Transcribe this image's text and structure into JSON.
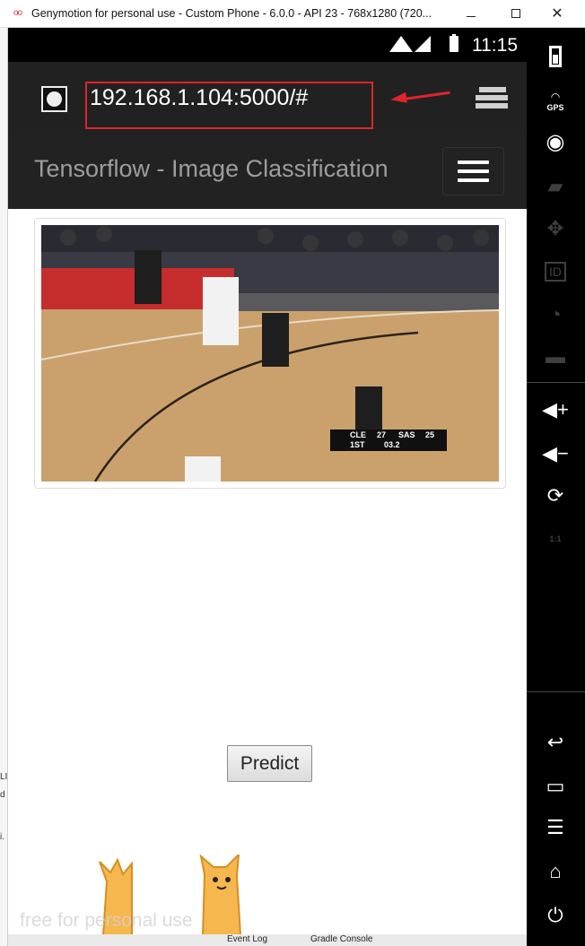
{
  "window": {
    "title": "Genymotion for personal use - Custom Phone - 6.0.0 - API 23 - 768x1280 (720...",
    "controls": {
      "minimize": "minimize-icon",
      "maximize": "maximize-icon",
      "close": "✕"
    }
  },
  "status_bar": {
    "time": "11:15",
    "icons": [
      "wifi-icon",
      "signal-icon",
      "battery-icon"
    ]
  },
  "browser": {
    "url": "192.168.1.104:5000/#",
    "annotation_color": "#e0242a"
  },
  "app": {
    "title": "Tensorflow - Image Classification",
    "navbar_color": "#222222",
    "image": {
      "scoreboard": {
        "team1": "CLE",
        "score1": "27",
        "team2": "SAS",
        "score2": "25",
        "period": "1ST",
        "clock": "03.2"
      }
    },
    "predict_label": "Predict"
  },
  "watermark": "free for personal use",
  "side_panel": {
    "gps_label": "GPS",
    "icons": [
      "battery-icon",
      "gps-icon",
      "webcam-icon",
      "capture-icon",
      "move-icon",
      "id-icon",
      "rss-icon",
      "sms-icon",
      "volume-up-icon",
      "volume-down-icon",
      "rotate-icon",
      "scale-icon",
      "back-icon",
      "recent-apps-icon",
      "menu-icon",
      "home-icon",
      "power-icon"
    ],
    "scale_label": "1:1"
  },
  "host_window": {
    "fragments": [
      "LI",
      "d",
      "i."
    ],
    "bottom_tabs": [
      "Event Log",
      "Gradle Console"
    ]
  }
}
